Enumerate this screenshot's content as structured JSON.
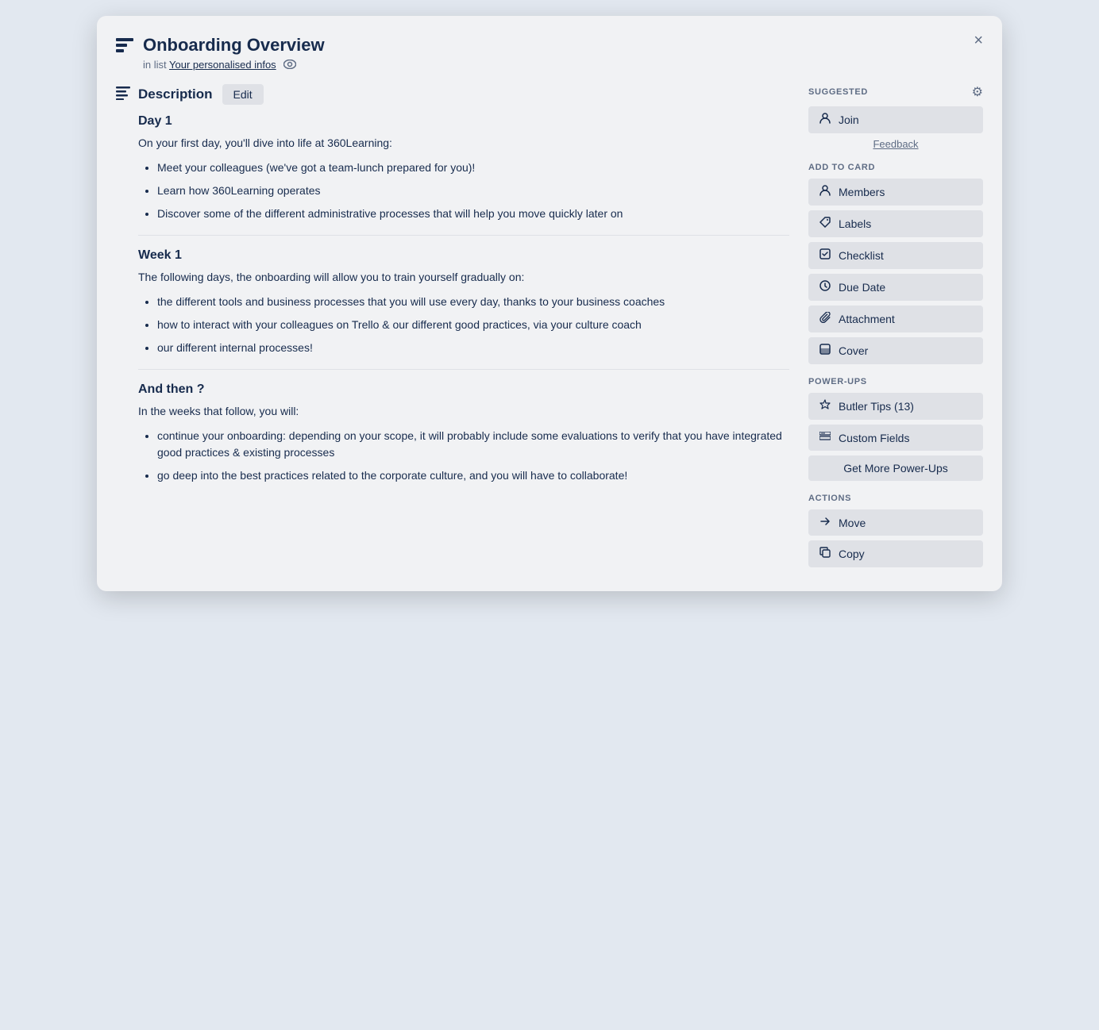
{
  "modal": {
    "title": "Onboarding Overview",
    "subtitle_prefix": "in list",
    "list_link": "Your personalised infos",
    "close_label": "×"
  },
  "description": {
    "title": "Description",
    "edit_label": "Edit",
    "sections": [
      {
        "heading": "Day 1",
        "intro": "On your first day, you'll dive into life at 360Learning:",
        "items": [
          "Meet your colleagues (we've got a team-lunch prepared for you)!",
          "Learn how 360Learning operates",
          "Discover some of the different administrative processes that will help you move quickly later on"
        ]
      },
      {
        "heading": "Week 1",
        "intro": "The following days, the onboarding will allow you to train yourself gradually on:",
        "items": [
          "the different tools and business processes that you will use every day, thanks to your business coaches",
          "how to interact with your colleagues on Trello & our different good practices, via your culture coach",
          "our different internal processes!"
        ]
      },
      {
        "heading": "And then ?",
        "intro": "In the weeks that follow, you will:",
        "items": [
          "continue your onboarding: depending on your scope, it will probably include some evaluations to verify that you have integrated good practices & existing processes",
          "go deep into the best practices related to the corporate culture, and you will have to collaborate!"
        ]
      }
    ]
  },
  "sidebar": {
    "suggested_label": "SUGGESTED",
    "join_label": "Join",
    "feedback_label": "Feedback",
    "add_to_card_label": "ADD TO CARD",
    "members_label": "Members",
    "labels_label": "Labels",
    "checklist_label": "Checklist",
    "due_date_label": "Due Date",
    "attachment_label": "Attachment",
    "cover_label": "Cover",
    "power_ups_label": "POWER-UPS",
    "butler_tips_label": "Butler Tips (13)",
    "custom_fields_label": "Custom Fields",
    "get_more_label": "Get More Power-Ups",
    "actions_label": "ACTIONS",
    "move_label": "Move",
    "copy_label": "Copy"
  }
}
